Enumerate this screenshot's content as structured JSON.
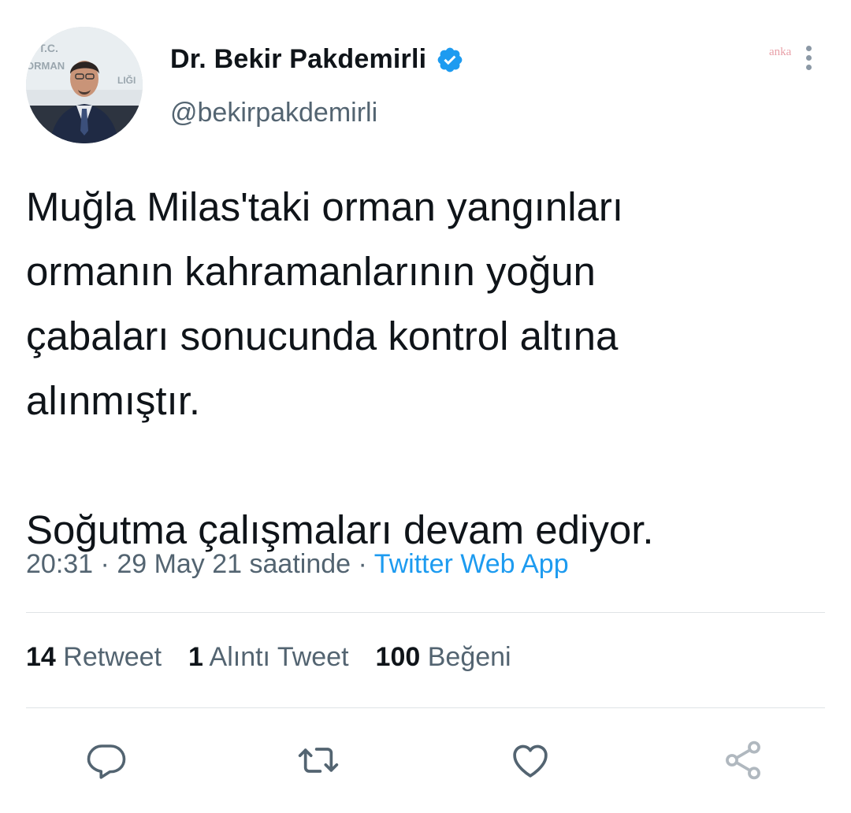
{
  "tweet": {
    "author": {
      "display_name": "Dr. Bekir Pakdemirli",
      "handle": "@bekirpakdemirli",
      "verified": true,
      "avatar_backdrop_text": "T.C. ORMAN ... LIĞI"
    },
    "text": "Muğla Milas'taki orman yangınları\normanın kahramanlarının yoğun\nçabaları sonucunda kontrol altına\nalınmıştır.\n\nSoğutma çalışmaları devam ediyor.",
    "time": "20:31",
    "date": "29 May 21 saatinde",
    "separator": " · ",
    "source": "Twitter Web App",
    "stats": {
      "retweets": {
        "count": "14",
        "label": "Retweet"
      },
      "quotes": {
        "count": "1",
        "label": "Alıntı Tweet"
      },
      "likes": {
        "count": "100",
        "label": "Beğeni"
      }
    }
  },
  "watermark": "anka",
  "colors": {
    "text": "#0f1419",
    "secondary": "#536471",
    "accent": "#1d9bf0",
    "divider": "#dfe3e6",
    "icon": "#536471",
    "verified": "#1d9bf0"
  },
  "icons": [
    "verified-badge-icon",
    "more-options-icon",
    "reply-icon",
    "retweet-icon",
    "like-icon",
    "share-icon"
  ]
}
